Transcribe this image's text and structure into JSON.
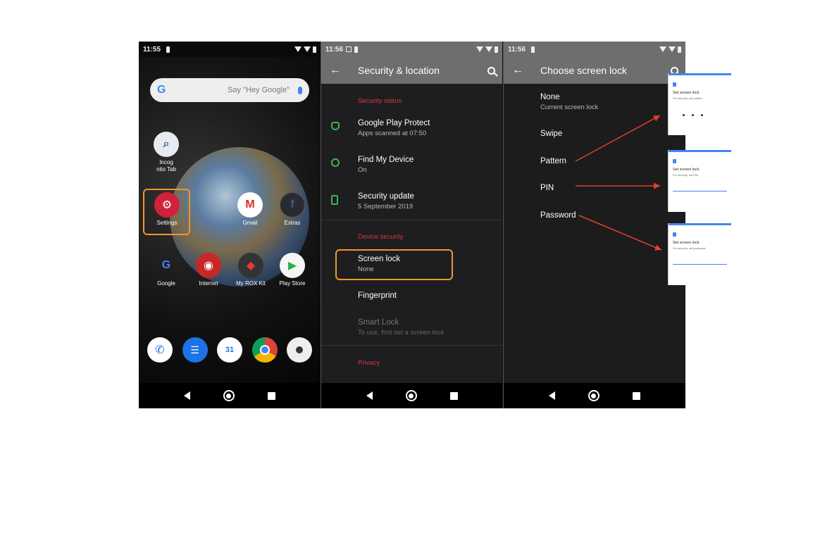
{
  "home": {
    "time": "11:55",
    "search_hint": "Say \"Hey Google\"",
    "apps": [
      {
        "label": "Incog nito Tab",
        "glyph": "⌕"
      },
      {
        "label": "Settings",
        "glyph": "⚙"
      },
      {
        "label": "Gmail",
        "glyph": "M"
      },
      {
        "label": "Extras",
        "glyph": "f"
      },
      {
        "label": "Google",
        "glyph": "G"
      },
      {
        "label": "Internet",
        "glyph": "◉"
      },
      {
        "label": "My ROX Kit",
        "glyph": "◆"
      },
      {
        "label": "Play Store",
        "glyph": "▶"
      }
    ],
    "dock": [
      "phone-icon",
      "messages-icon",
      "calendar-icon",
      "chrome-icon",
      "camera-icon"
    ],
    "calendar_day": "31"
  },
  "security": {
    "time": "11:56",
    "title": "Security & location",
    "section_status": "Security status",
    "items": [
      {
        "title": "Google Play Protect",
        "sub": "Apps scanned at 07:50"
      },
      {
        "title": "Find My Device",
        "sub": "On"
      },
      {
        "title": "Security update",
        "sub": "5 September 2019"
      }
    ],
    "section_device": "Device security",
    "screen_lock": {
      "title": "Screen lock",
      "sub": "None"
    },
    "fingerprint": "Fingerprint",
    "smart_lock": {
      "title": "Smart Lock",
      "sub": "To use, first set a screen lock"
    },
    "section_privacy": "Privacy"
  },
  "choose_lock": {
    "time": "11:56",
    "title": "Choose screen lock",
    "options": [
      {
        "title": "None",
        "sub": "Current screen lock"
      },
      {
        "title": "Swipe",
        "sub": ""
      },
      {
        "title": "Pattern",
        "sub": ""
      },
      {
        "title": "PIN",
        "sub": ""
      },
      {
        "title": "Password",
        "sub": ""
      }
    ]
  },
  "previews": [
    {
      "title": "Set screen lock",
      "sub": "For security, set pattern"
    },
    {
      "title": "Set screen lock",
      "sub": "For security, set PIN"
    },
    {
      "title": "Set screen lock",
      "sub": "For security, set password"
    }
  ],
  "colors": {
    "accent_red": "#d8393a",
    "highlight_orange": "#f0962a",
    "arrow_red": "#e04030",
    "protect_green": "#3bb65b"
  }
}
